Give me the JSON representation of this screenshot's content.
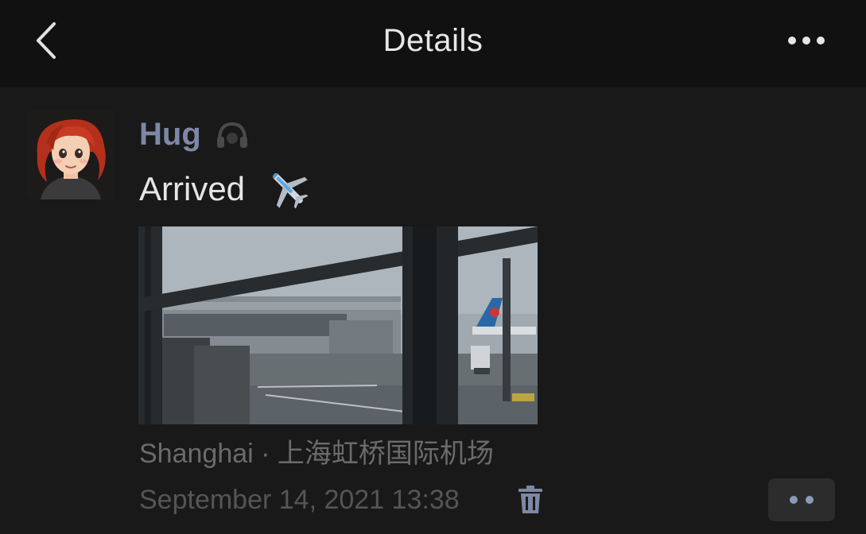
{
  "header": {
    "title": "Details",
    "back_icon": "chevron-left-icon",
    "more_icon": "more-horizontal-icon"
  },
  "post": {
    "author": "Hug",
    "author_color": "#7d87a6",
    "status_icon": "headphones-icon",
    "text": "Arrived",
    "emoji_icon": "airplane-icon",
    "location": "Shanghai · 上海虹桥国际机场",
    "timestamp": "September 14, 2021 13:38",
    "delete_icon": "trash-icon",
    "action_icon": "comment-like-menu-icon"
  },
  "colors": {
    "background": "#191919",
    "header_background": "#111111",
    "action_dot": "#8a9bb8"
  }
}
